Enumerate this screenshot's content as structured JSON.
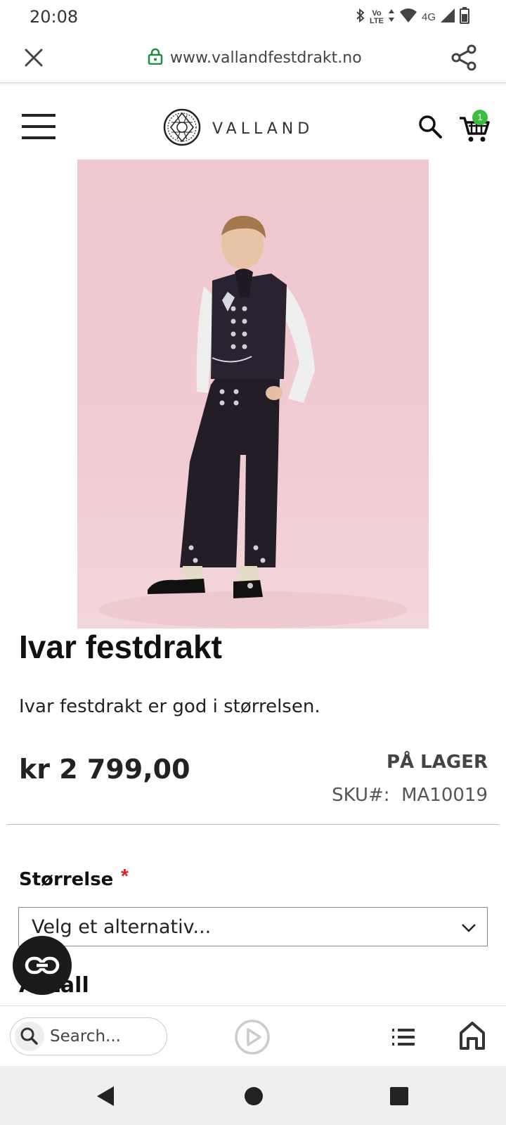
{
  "status_bar": {
    "time": "20:08",
    "network_label_1": "Vo",
    "network_label_2": "LTE",
    "network_type": "4G",
    "icons": [
      "bluetooth-icon",
      "volte-icon",
      "wifi-icon",
      "signal-icon",
      "battery-icon"
    ]
  },
  "browser": {
    "url": "www.vallandfestdrakt.no",
    "icons": [
      "close-icon",
      "lock-icon",
      "share-icon"
    ]
  },
  "site_header": {
    "brand": "VALLAND",
    "cart_count": "1",
    "icons": [
      "menu-icon",
      "logo-icon",
      "search-icon",
      "cart-icon"
    ]
  },
  "product": {
    "title": "Ivar festdrakt",
    "description": "Ivar festdrakt er god i størrelsen.",
    "price": "kr 2 799,00",
    "stock_status": "PÅ LAGER",
    "sku": "SKU#:  MA10019",
    "size_label": "Størrelse",
    "required_marker": "*",
    "size_select_value": "Velg et alternativ...",
    "next_option_label": "Antall"
  },
  "bottom_toolbar": {
    "search_placeholder": "Search...",
    "icons": [
      "search-icon",
      "play-icon",
      "list-icon",
      "home-icon"
    ]
  },
  "colors": {
    "cart_badge": "#3dbd3d",
    "required": "#dd2222",
    "lock": "#1e8e3e",
    "image_background": "#efc7ce"
  }
}
